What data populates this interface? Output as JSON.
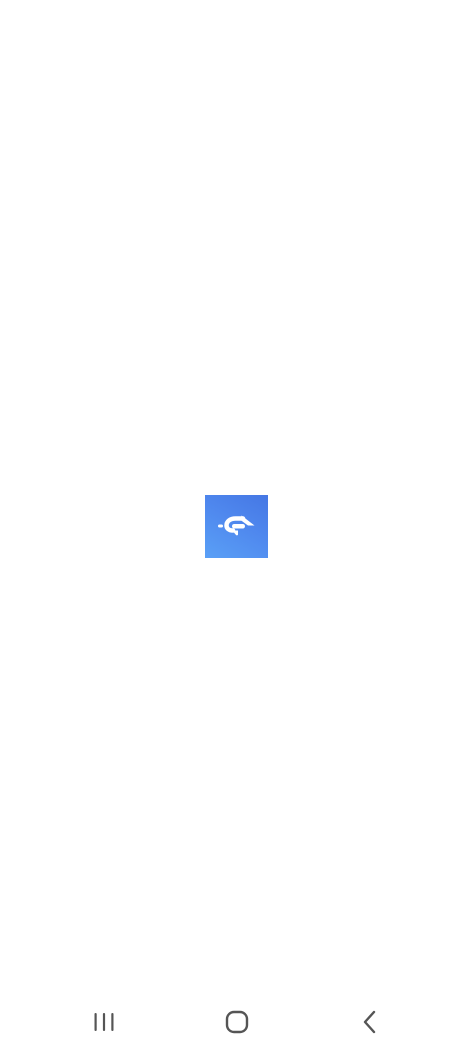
{
  "app": {
    "logo_icon": "app-logo-icon",
    "logo_gradient": [
      "#4577e4",
      "#5aa0f6"
    ],
    "logo_glyph_color": "#ffffff"
  },
  "navigation_bar": {
    "background": "#ffffff",
    "icon_color": "#555555",
    "buttons": [
      {
        "name": "recent-apps",
        "icon": "recent-apps-icon"
      },
      {
        "name": "home",
        "icon": "home-icon"
      },
      {
        "name": "back",
        "icon": "back-icon"
      }
    ]
  }
}
